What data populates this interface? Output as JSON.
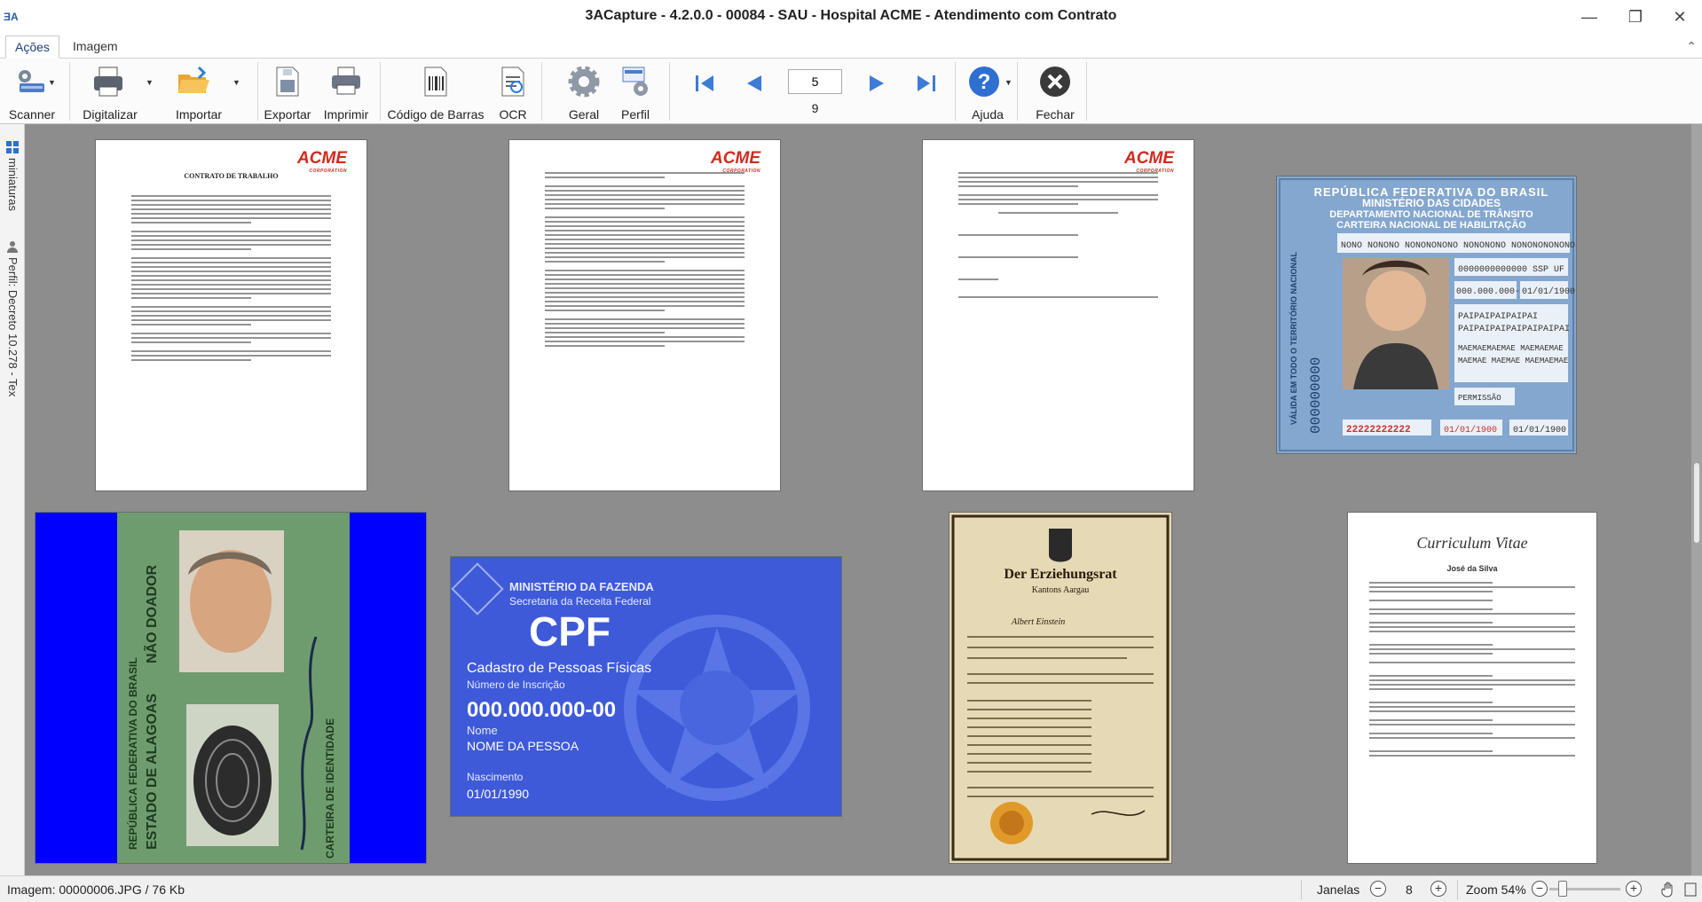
{
  "window": {
    "app_icon": "ƎA",
    "title": "3ACapture - 4.2.0.0 - 00084 -  SAU - Hospital ACME - Atendimento com Contrato",
    "minimize": "—",
    "restore": "❐",
    "close": "✕"
  },
  "ribbon": {
    "tabs": [
      "Ações",
      "Imagem"
    ],
    "collapse": "⌃"
  },
  "toolbar": {
    "scanner": "Scanner",
    "digitalizar": "Digitalizar",
    "importar": "Importar",
    "exportar": "Exportar",
    "imprimir": "Imprimir",
    "codigo_barras": "Código de Barras",
    "ocr": "OCR",
    "geral": "Geral",
    "perfil": "Perfil",
    "page_current": "5",
    "page_total": "9",
    "ajuda": "Ajuda",
    "fechar": "Fechar"
  },
  "sidebar": {
    "miniaturas": "miniaturas",
    "perfil": "Perfil: Decreto 10.278 - Tex"
  },
  "thumbnails": {
    "contract": {
      "logo": "ACME",
      "logo_sub": "CORPORATION",
      "title": "CONTRATO DE TRABALHO"
    },
    "cnh": {
      "header1": "REPÚBLICA FEDERATIVA DO BRASIL",
      "header2": "MINISTÉRIO DAS CIDADES",
      "header3": "DEPARTAMENTO NACIONAL DE TRÂNSITO",
      "header4": "CARTEIRA NACIONAL DE HABILITAÇÃO",
      "name": "NONO NONONO NONONONONO NONONONO NONONONONONO",
      "doc": "0000000000000 SSP UF",
      "cpf": "000.000.000-00",
      "birth": "01/01/1900",
      "parent1": "PAIPAIPAIPAIPAI",
      "parent2": "PAIPAIPAIPAIPAIPAIPAI",
      "mother1": "MAEMAEMAEMAE MAEMAEMAE",
      "mother2": "MAEMAE MAEMAE MAEMAEMAE",
      "permissao": "PERMISSÃO",
      "registro": "22222222222",
      "validade": "01/01/1900",
      "primeira": "01/01/1900",
      "side": "VÁLIDA EM TODO O TERRITÓRIO NACIONAL",
      "side_num": "000000000"
    },
    "rg": {
      "side1": "REPÚBLICA FEDERATIVA DO BRASIL",
      "side2": "ESTADO DE ALAGOAS",
      "side3": "NÃO DOADOR",
      "side4": "CARTEIRA DE IDENTIDADE"
    },
    "cpf": {
      "ministry": "MINISTÉRIO DA FAZENDA",
      "secretaria": "Secretaria da Receita Federal",
      "title": "CPF",
      "cadastro": "Cadastro de Pessoas Físicas",
      "inscricao": "Número de Inscrição",
      "number": "000.000.000-00",
      "nome_label": "Nome",
      "nome": "NOME DA PESSOA",
      "nasc_label": "Nascimento",
      "nasc": "01/01/1990"
    },
    "cert": {
      "title": "Der Erziehungsrat",
      "sub": "Kantons Aargau",
      "name": "Albert Einstein"
    },
    "cv": {
      "title": "Curriculum Vitae",
      "name": "José da Silva"
    }
  },
  "statusbar": {
    "image": "Imagem: 00000006.JPG / 76 Kb",
    "janelas_label": "Janelas",
    "janelas_value": "8",
    "zoom": "Zoom 54%"
  }
}
